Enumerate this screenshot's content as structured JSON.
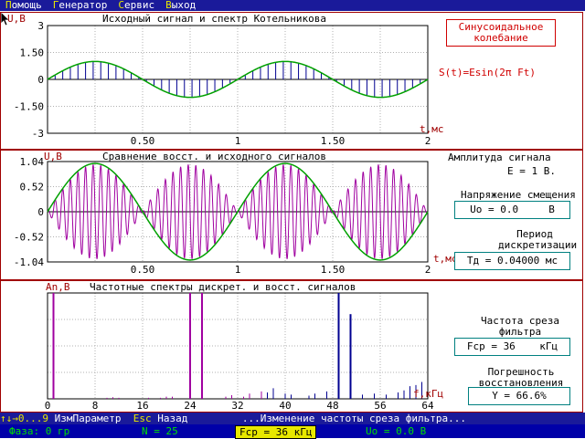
{
  "menu": {
    "items": [
      {
        "hotkey": "П",
        "rest": "омощь"
      },
      {
        "hotkey": "Г",
        "rest": "енератор"
      },
      {
        "hotkey": "С",
        "rest": "ервис"
      },
      {
        "hotkey": "В",
        "rest": "ыход"
      }
    ]
  },
  "panel1": {
    "title": "Исходный сигнал и спектр Котельникова",
    "ylabel": "U,B",
    "xlabel": "t,мс",
    "signal_label": "Синусоидальное\nколебание",
    "formula": "S(t)=Esin(2π Ft)"
  },
  "panel2": {
    "title": "Сравнение восст. и исходного сигналов",
    "ylabel": "U,B",
    "xlabel": "t,мс",
    "amp_heading": "Амплитуда сигнала",
    "amp_value": "E = 1 B.",
    "bias_heading": "Напряжение смещения",
    "bias_box": "Uo = 0.0     B",
    "period_heading": "Период\nдискретизации",
    "period_box": "Тд = 0.04000 мс"
  },
  "panel3": {
    "title": "Частотные спектры дискрет. и восст. сигналов",
    "ylabel": "An,B",
    "xlabel": "f,кГц",
    "cutoff_heading": "Частота среза\nфильтра",
    "cutoff_box": "Fср = 36    кГц",
    "error_heading": "Погрешность\nвосстановления",
    "error_box": "Y = 66.6%"
  },
  "hint": {
    "keys": "↑↓→0...9",
    "keys_action": " ИзмПараметр  ",
    "esc": "Esc",
    "esc_action": " Назад         ...Изменение частоты среза фильтра..."
  },
  "status": {
    "phase": "Фаза: 0 гр",
    "n": "N = 25",
    "fcp": "Fср = 36 кГц",
    "uo": "Uo = 0.0 В"
  },
  "chart_data": [
    {
      "type": "line",
      "title": "Исходный сигнал и спектр Котельникова",
      "xlabel": "t,мс",
      "ylabel": "U,B",
      "xlim": [
        0,
        2
      ],
      "ylim": [
        -3,
        3
      ],
      "xticks": [
        "0.50",
        "1",
        "1.50",
        "2"
      ],
      "yticks": [
        "3",
        "1.50",
        "0",
        "-1.50",
        "-3"
      ],
      "series": [
        {
          "kind": "sine",
          "amplitude": 1,
          "frequency_khz": 1,
          "color": "#00a000"
        },
        {
          "kind": "samples",
          "period_ms": 0.04,
          "color": "#000090"
        }
      ]
    },
    {
      "type": "line",
      "title": "Сравнение восст. и исходного сигналов",
      "xlabel": "t,мс",
      "ylabel": "U,B",
      "xlim": [
        0,
        2
      ],
      "ylim": [
        -1.04,
        1.04
      ],
      "xticks": [
        "0.50",
        "1",
        "1.50",
        "2"
      ],
      "yticks": [
        "1.04",
        "0.52",
        "0",
        "-0.52",
        "-1.04"
      ],
      "series": [
        {
          "kind": "sine",
          "amplitude": 1,
          "frequency_khz": 1,
          "color": "#00a000"
        },
        {
          "kind": "reconstructed",
          "color": "#a000a0"
        }
      ]
    },
    {
      "type": "bar",
      "title": "Частотные спектры дискрет. и восст. сигналов",
      "xlabel": "f,кГц",
      "ylabel": "An,B",
      "xlim": [
        0,
        64
      ],
      "ylim": [
        0,
        1
      ],
      "xticks": [
        "0",
        "8",
        "16",
        "24",
        "32",
        "40",
        "48",
        "56",
        "64"
      ],
      "series": [
        {
          "name": "discrete",
          "color": "#000090",
          "x": [
            1,
            24,
            26,
            49,
            51,
            37,
            38,
            40,
            41,
            44,
            45,
            47,
            53,
            55,
            57,
            59,
            60,
            61,
            62,
            63
          ],
          "values": [
            1,
            1,
            1,
            1,
            0.8,
            0.06,
            0.1,
            0.05,
            0.04,
            0.03,
            0.05,
            0.07,
            0.04,
            0.05,
            0.04,
            0.06,
            0.08,
            0.12,
            0.13,
            0.16
          ]
        },
        {
          "name": "reconstructed",
          "color": "#a000a0",
          "x": [
            1,
            24,
            26,
            10,
            11,
            12,
            17,
            19,
            20,
            21,
            30,
            31,
            33,
            34,
            36
          ],
          "values": [
            1,
            1,
            1,
            0.01,
            0.015,
            0.01,
            0.01,
            0.01,
            0.02,
            0.02,
            0.02,
            0.035,
            0.02,
            0.05,
            0.07
          ]
        }
      ]
    }
  ]
}
